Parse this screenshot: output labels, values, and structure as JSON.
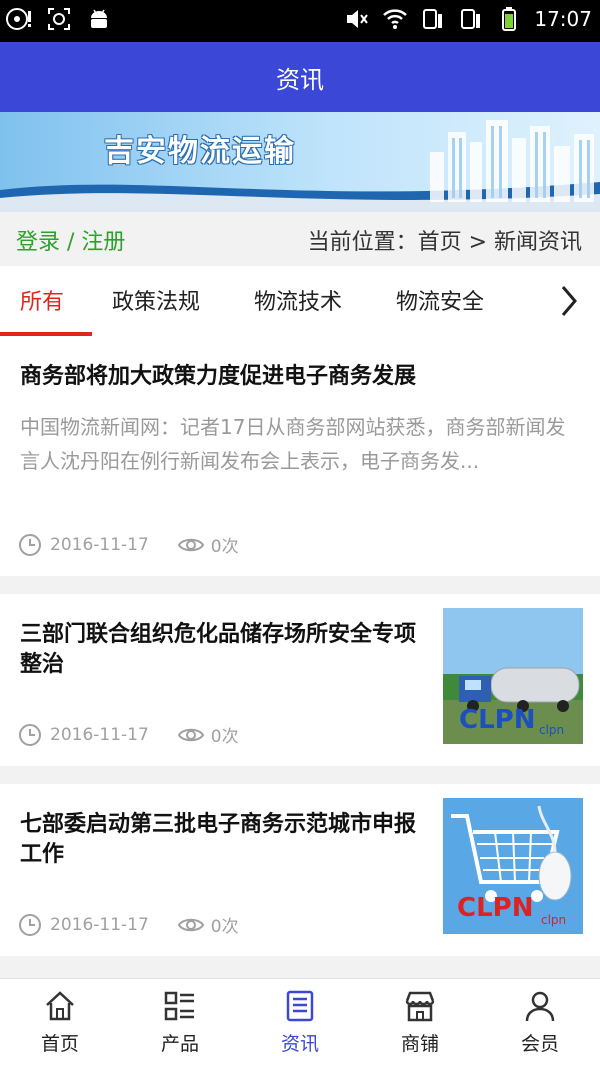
{
  "status_bar": {
    "time": "17:07"
  },
  "app_bar": {
    "title": "资讯"
  },
  "banner": {
    "title": "吉安物流运输"
  },
  "breadcrumb": {
    "login": "登录 / 注册",
    "location": "当前位置：首页 > 新闻资讯"
  },
  "tabs": [
    {
      "label": "所有",
      "active": true
    },
    {
      "label": "政策法规"
    },
    {
      "label": "物流技术"
    },
    {
      "label": "物流安全"
    }
  ],
  "articles": [
    {
      "title": "商务部将加大政策力度促进电子商务发展",
      "desc": "中国物流新闻网：记者17日从商务部网站获悉，商务部新闻发言人沈丹阳在例行新闻发布会上表示，电子商务发...",
      "date": "2016-11-17",
      "views": "0次"
    },
    {
      "title": "三部门联合组织危化品储存场所安全专项整治",
      "date": "2016-11-17",
      "views": "0次",
      "thumb_watermark": "CLPN",
      "thumb_small": "clpn"
    },
    {
      "title": "七部委启动第三批电子商务示范城市申报工作",
      "date": "2016-11-17",
      "views": "0次",
      "thumb_watermark": "CLPN",
      "thumb_small": "clpn"
    }
  ],
  "bottom_nav": [
    {
      "label": "首页",
      "icon": "home-icon"
    },
    {
      "label": "产品",
      "icon": "grid-list-icon"
    },
    {
      "label": "资讯",
      "icon": "news-icon",
      "active": true
    },
    {
      "label": "商铺",
      "icon": "store-icon"
    },
    {
      "label": "会员",
      "icon": "user-icon"
    }
  ],
  "colors": {
    "primary": "#3b47d6",
    "accent_red": "#e0251b",
    "login_green": "#2ea02e"
  }
}
